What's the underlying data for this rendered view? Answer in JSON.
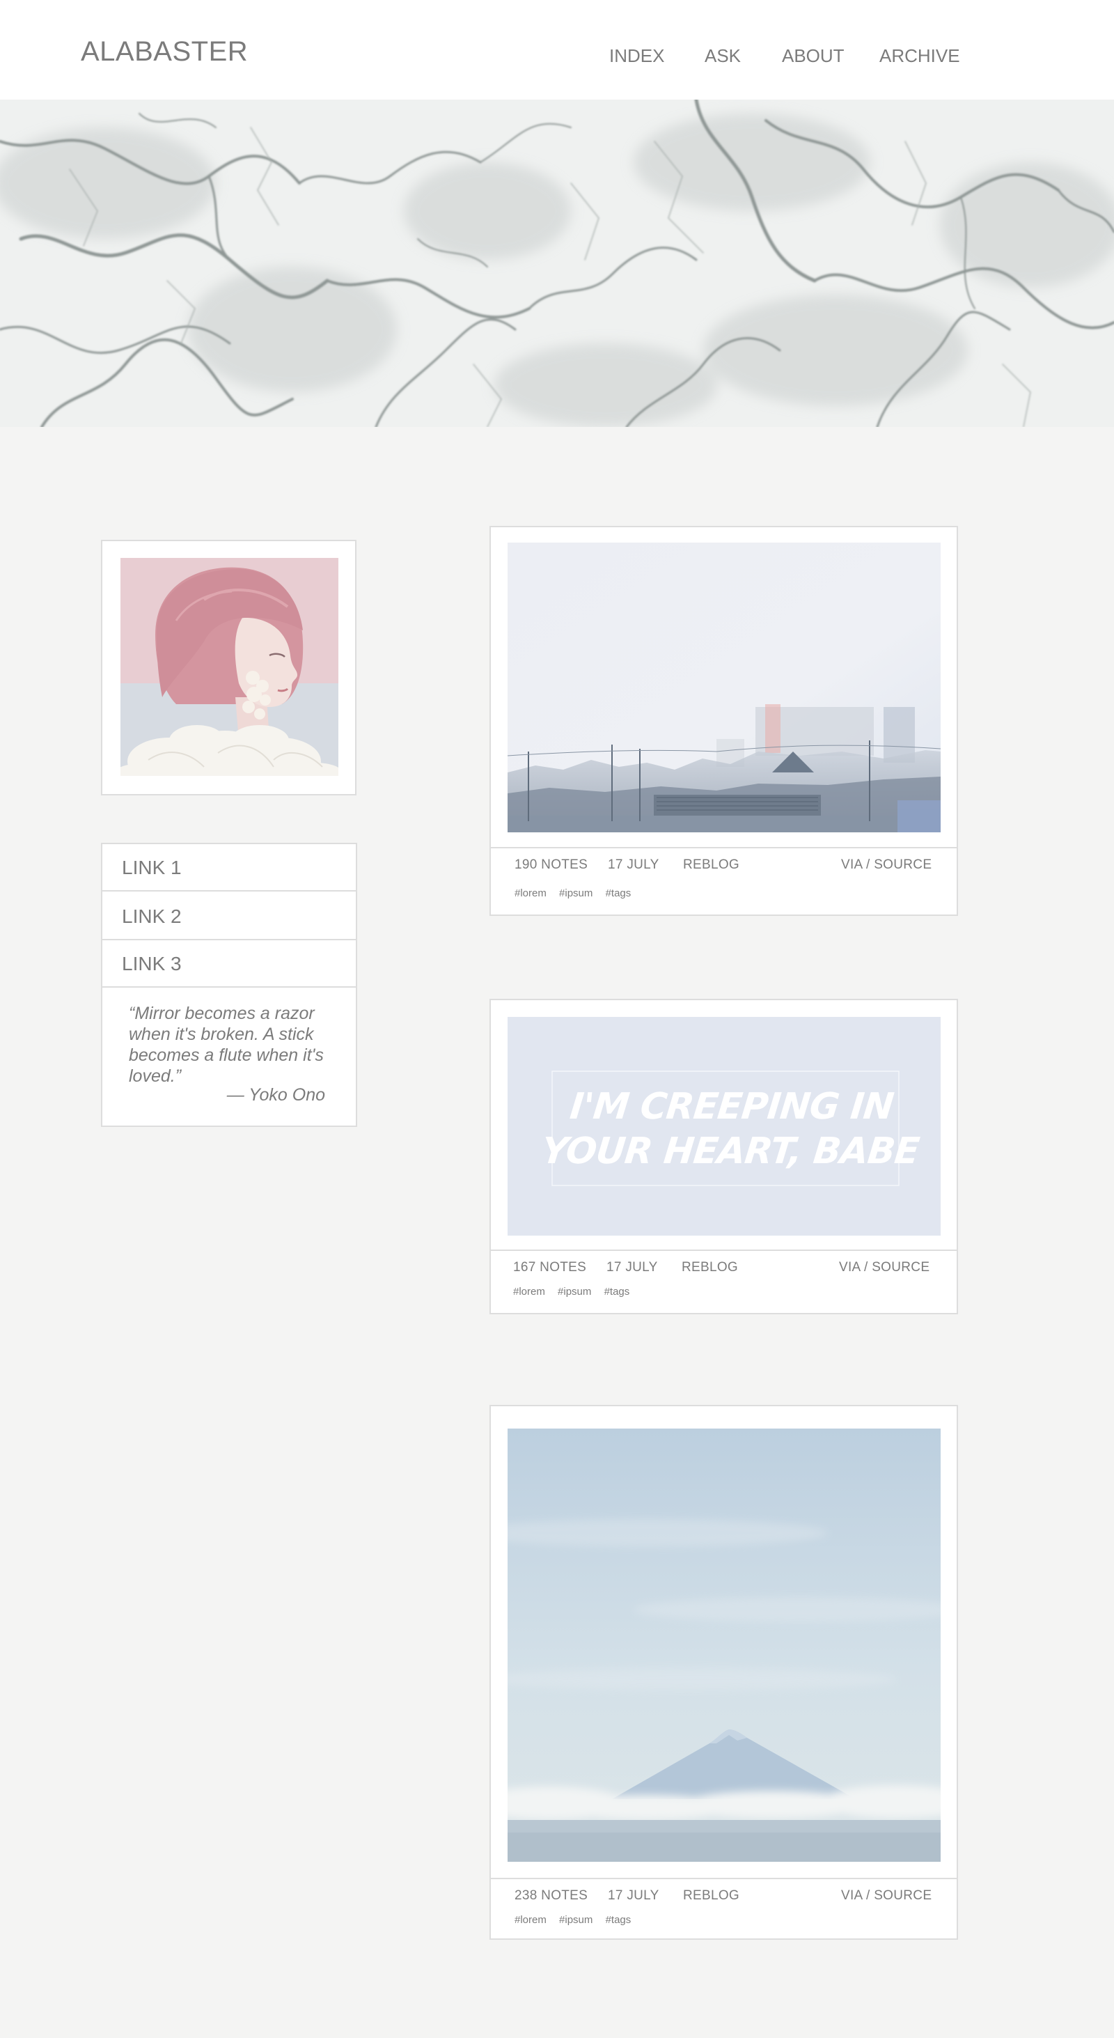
{
  "header": {
    "title": "ALABASTER",
    "nav": [
      "INDEX",
      "ASK",
      "ABOUT",
      "ARCHIVE"
    ]
  },
  "sidebar": {
    "links": [
      "LINK 1",
      "LINK 2",
      "LINK 3"
    ],
    "quote": "“Mirror becomes a razor when it's broken. A stick becomes a flute when it's loved.”",
    "quote_author": "— Yoko Ono"
  },
  "posts": [
    {
      "notes": "190 NOTES",
      "date": "17 JULY",
      "reblog": "REBLOG",
      "source": "VIA / SOURCE",
      "tags": [
        "#lorem",
        "#ipsum",
        "#tags"
      ]
    },
    {
      "image_text_line1": "I'M CREEPING IN",
      "image_text_line2": "YOUR HEART, BABE",
      "notes": "167 NOTES",
      "date": "17 JULY",
      "reblog": "REBLOG",
      "source": "VIA / SOURCE",
      "tags": [
        "#lorem",
        "#ipsum",
        "#tags"
      ]
    },
    {
      "notes": "238 NOTES",
      "date": "17 JULY",
      "reblog": "REBLOG",
      "source": "VIA / SOURCE",
      "tags": [
        "#lorem",
        "#ipsum",
        "#tags"
      ]
    }
  ],
  "colors": {
    "background": "#f4f4f3",
    "text": "#7b7b7b",
    "border": "#dddddd",
    "card": "#ffffff"
  }
}
